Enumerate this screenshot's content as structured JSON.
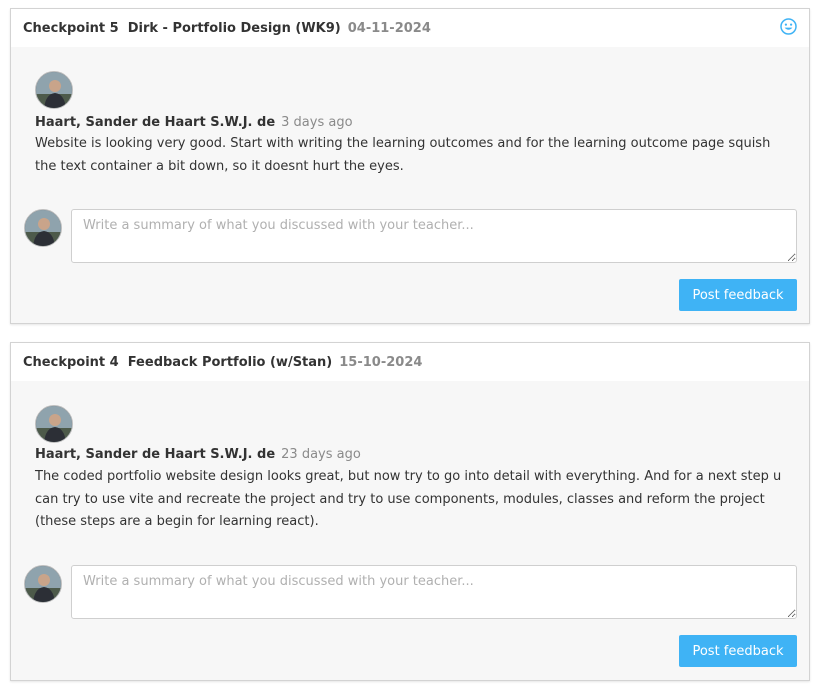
{
  "checkpoints": [
    {
      "label": "Checkpoint 5",
      "title": "Dirk - Portfolio Design (WK9)",
      "date": "04-11-2024",
      "has_smiley": true,
      "smiley_icon": "smiley-face-icon",
      "smiley_color": "#3fb3f5",
      "feedback": {
        "author": "Haart, Sander de Haart S.W.J. de",
        "time_ago": "3 days ago",
        "text": "Website is looking very good. Start with writing the learning outcomes and for the learning outcome page squish the text container a bit down, so it doesnt hurt the eyes."
      },
      "input_placeholder": "Write a summary of what you discussed with your teacher...",
      "input_value": "",
      "button_label": "Post feedback"
    },
    {
      "label": "Checkpoint 4",
      "title": "Feedback Portfolio (w/Stan)",
      "date": "15-10-2024",
      "has_smiley": false,
      "feedback": {
        "author": "Haart, Sander de Haart S.W.J. de",
        "time_ago": "23 days ago",
        "text": "The coded portfolio website design looks great, but now try to go into detail with everything. And for a next step u can try to use vite and recreate the project and try to use components, modules, classes and reform the project (these steps are a begin for learning react)."
      },
      "input_placeholder": "Write a summary of what you discussed with your teacher...",
      "input_value": "",
      "button_label": "Post feedback"
    }
  ],
  "colors": {
    "accent": "#3fb3f5",
    "card_background": "#f7f7f7",
    "header_background": "#ffffff",
    "muted_text": "#8a8a8a"
  }
}
